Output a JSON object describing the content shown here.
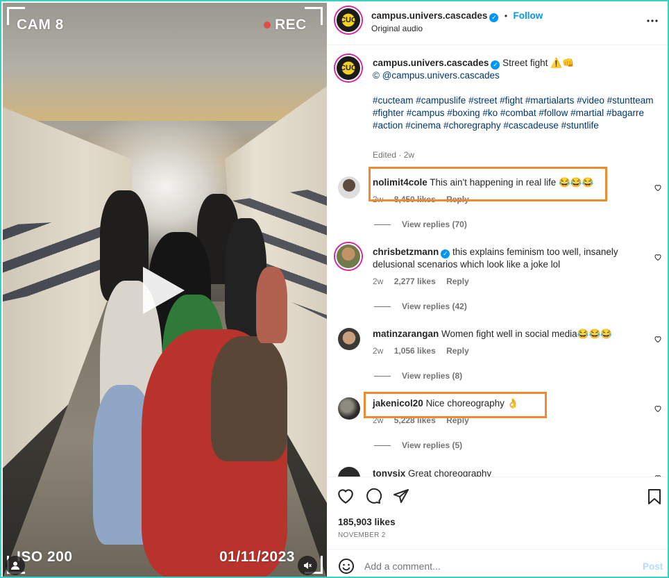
{
  "video": {
    "cam_label": "CAM 8",
    "rec_label": "REC",
    "iso_label": "ISO 200",
    "date_label": "01/11/2023"
  },
  "header": {
    "username": "campus.univers.cascades",
    "follow_label": "Follow",
    "separator": "•",
    "audio": "Original audio",
    "more_icon": "more-horizontal-icon"
  },
  "caption": {
    "username": "campus.univers.cascades",
    "title": "Street fight ⚠️👊",
    "credit": "© @campus.univers.cascades",
    "tags": "#cucteam #campuslife #street #fight #martialarts #video #stuntteam #fighter #campus #boxing #ko #combat #follow #martial #bagarre #action #cinema #choregraphy #cascadeuse #stuntlife",
    "edited": "Edited · 2w"
  },
  "comments": [
    {
      "username": "nolimit4cole",
      "text": "This ain't happening in real life 😂😂😂",
      "time": "2w",
      "likes": "8,450 likes",
      "reply": "Reply",
      "view_replies": "View replies (70)",
      "verified": false
    },
    {
      "username": "chrisbetzmann",
      "text": "this explains feminism too well, insanely delusional scenarios which look like a joke lol",
      "time": "2w",
      "likes": "2,277 likes",
      "reply": "Reply",
      "view_replies": "View replies (42)",
      "verified": true
    },
    {
      "username": "matinzarangan",
      "text": "Women fight well in social media😂😂😂",
      "time": "2w",
      "likes": "1,056 likes",
      "reply": "Reply",
      "view_replies": "View replies (8)",
      "verified": false
    },
    {
      "username": "jakenicol20",
      "text": "Nice choreography 👌",
      "time": "2w",
      "likes": "5,228 likes",
      "reply": "Reply",
      "view_replies": "View replies (5)",
      "verified": false
    },
    {
      "username": "tonysix",
      "text": "Great choreography",
      "verified": false
    }
  ],
  "actions": {
    "likes": "185,903 likes",
    "date": "NOVEMBER 2"
  },
  "composer": {
    "placeholder": "Add a comment...",
    "post_label": "Post"
  },
  "colors": {
    "accent": "#0095f6",
    "highlight": "#f08a32",
    "frame": "#3ad0c8"
  }
}
